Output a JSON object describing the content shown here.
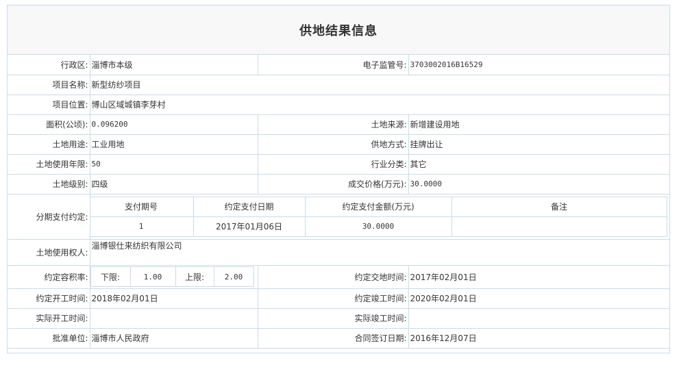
{
  "title": "供地结果信息",
  "rows": {
    "district": {
      "label": "行政区:",
      "value": "淄博市本级"
    },
    "supervision_no": {
      "label": "电子监管号:",
      "value": "3703002016B16529"
    },
    "project_name": {
      "label": "项目名称:",
      "value": "新型纺纱项目"
    },
    "project_location": {
      "label": "项目位置:",
      "value": "博山区域城镇李芽村"
    },
    "area": {
      "label": "面积(公顷):",
      "value": "0.096200"
    },
    "land_source": {
      "label": "土地来源:",
      "value": "新增建设用地"
    },
    "land_use": {
      "label": "土地用途:",
      "value": "工业用地"
    },
    "supply_method": {
      "label": "供地方式:",
      "value": "挂牌出让"
    },
    "use_years": {
      "label": "土地使用年限:",
      "value": "50"
    },
    "industry": {
      "label": "行业分类:",
      "value": "其它"
    },
    "land_grade": {
      "label": "土地级别:",
      "value": "四级"
    },
    "price": {
      "label": "成交价格(万元):",
      "value": "30.0000"
    },
    "installments": {
      "label": "分期支付约定:",
      "headers": [
        "支付期号",
        "约定支付日期",
        "约定支付金额(万元)",
        "备注"
      ],
      "rows": [
        [
          "1",
          "2017年01月06日",
          "30.0000",
          ""
        ]
      ]
    },
    "land_user": {
      "label": "土地使用权人:",
      "value": "淄博银仕来纺织有限公司"
    },
    "far": {
      "label": "约定容积率:",
      "lower_label": "下限:",
      "lower_value": "1.00",
      "upper_label": "上限:",
      "upper_value": "2.00"
    },
    "handover_time": {
      "label": "约定交地时间:",
      "value": "2017年02月01日"
    },
    "start_time": {
      "label": "约定开工时间:",
      "value": "2018年02月01日"
    },
    "completion_time": {
      "label": "约定竣工时间:",
      "value": "2020年02月01日"
    },
    "actual_start": {
      "label": "实际开工时间:",
      "value": ""
    },
    "actual_completion": {
      "label": "实际竣工时间:",
      "value": ""
    },
    "approver": {
      "label": "批准单位:",
      "value": "淄博市人民政府"
    },
    "contract_date": {
      "label": "合同签订日期:",
      "value": "2016年12月07日"
    }
  }
}
